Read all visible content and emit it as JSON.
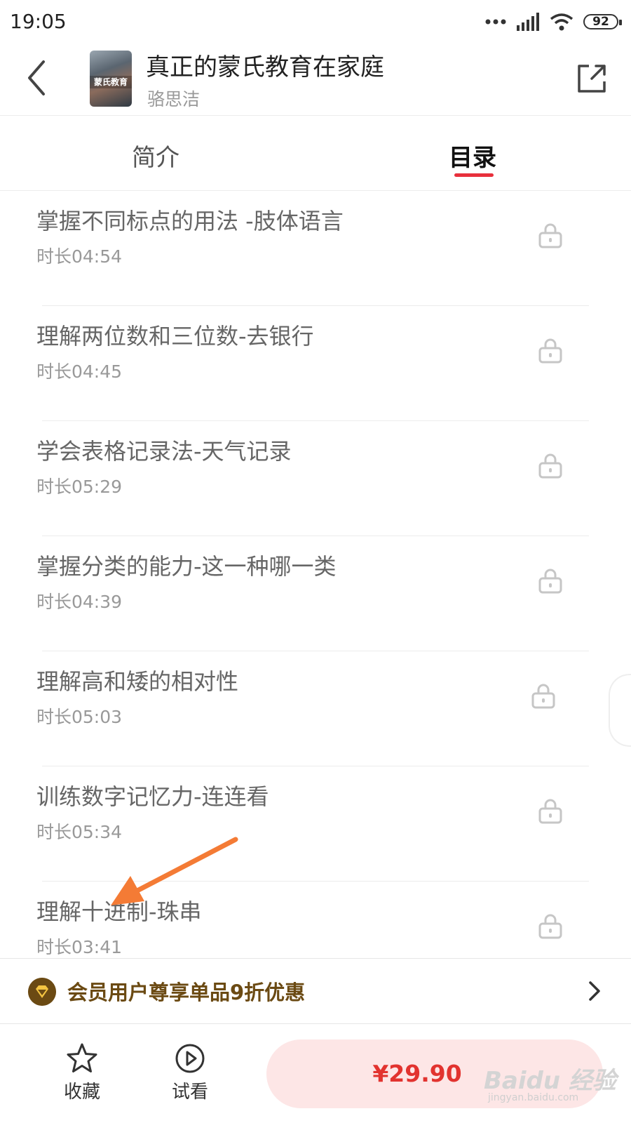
{
  "status_bar": {
    "time": "19:05",
    "battery": "92"
  },
  "header": {
    "cover_text": "蒙氏教育",
    "title": "真正的蒙氏教育在家庭",
    "author": "骆思洁"
  },
  "tabs": {
    "intro": "简介",
    "toc": "目录",
    "active": "toc"
  },
  "chapters": [
    {
      "title": "掌握不同标点的用法 -肢体语言",
      "duration": "时长04:54",
      "locked": true
    },
    {
      "title": "理解两位数和三位数-去银行",
      "duration": "时长04:45",
      "locked": true
    },
    {
      "title": "学会表格记录法-天气记录",
      "duration": "时长05:29",
      "locked": true
    },
    {
      "title": "掌握分类的能力-这一种哪一类",
      "duration": "时长04:39",
      "locked": true
    },
    {
      "title": "理解高和矮的相对性",
      "duration": "时长05:03",
      "locked": true
    },
    {
      "title": "训练数字记忆力-连连看",
      "duration": "时长05:34",
      "locked": true
    },
    {
      "title": "理解十进制-珠串",
      "duration": "时长03:41",
      "locked": true
    }
  ],
  "member_bar": {
    "text": "会员用户尊享单品9折优惠"
  },
  "bottom_bar": {
    "favorite_label": "收藏",
    "trial_label": "试看",
    "price": "¥29.90"
  },
  "watermark": {
    "main": "Baidu 经验",
    "sub": "jingyan.baidu.com"
  },
  "colors": {
    "accent": "#e8303c",
    "price": "#e2332f",
    "member": "#6b4a13",
    "annotation_arrow": "#f47b35"
  },
  "icons": {
    "back": "chevron-left-icon",
    "share": "share-icon",
    "lock": "lock-icon",
    "member": "member-diamond-icon",
    "favorite": "star-icon",
    "trial": "play-circle-icon"
  }
}
